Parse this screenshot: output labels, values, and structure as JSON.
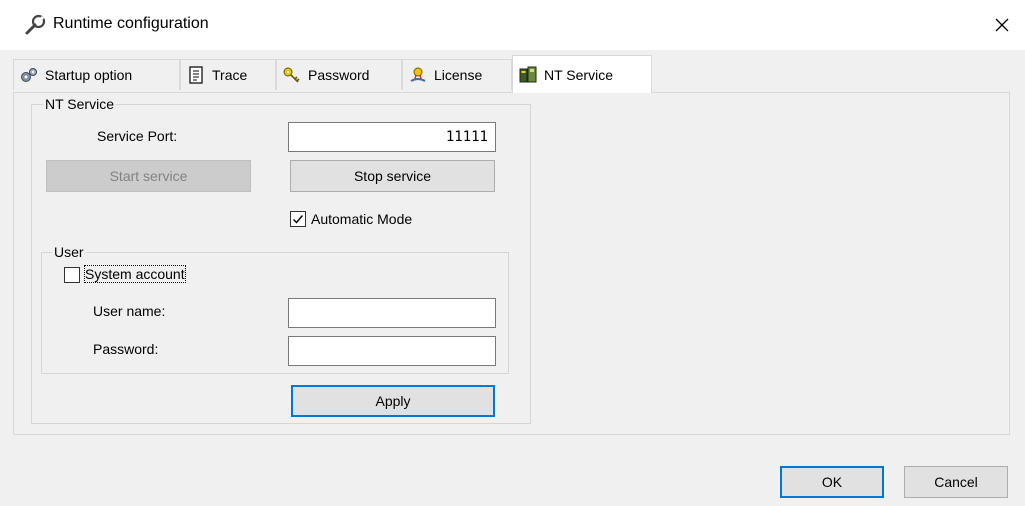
{
  "window": {
    "title": "Runtime configuration",
    "close_glyph": "✕"
  },
  "tabs": [
    {
      "label": "Startup option",
      "icon": "gears-icon"
    },
    {
      "label": "Trace",
      "icon": "notepad-icon"
    },
    {
      "label": "Password",
      "icon": "keys-icon"
    },
    {
      "label": "License",
      "icon": "license-certificate-icon"
    },
    {
      "label": "NT Service",
      "icon": "service-computer-icon",
      "active": true
    }
  ],
  "nt_service": {
    "group_label": "NT Service",
    "port_label": "Service Port:",
    "port_value": "11111",
    "start_button": "Start service",
    "stop_button": "Stop service",
    "automatic_mode": {
      "label": "Automatic Mode",
      "checked": true
    }
  },
  "user": {
    "group_label": "User",
    "system_account": {
      "label": "System account",
      "checked": false
    },
    "username_label": "User name:",
    "username_value": "",
    "password_label": "Password:",
    "password_value": ""
  },
  "apply_button": "Apply",
  "footer": {
    "ok_button": "OK",
    "cancel_button": "Cancel"
  }
}
